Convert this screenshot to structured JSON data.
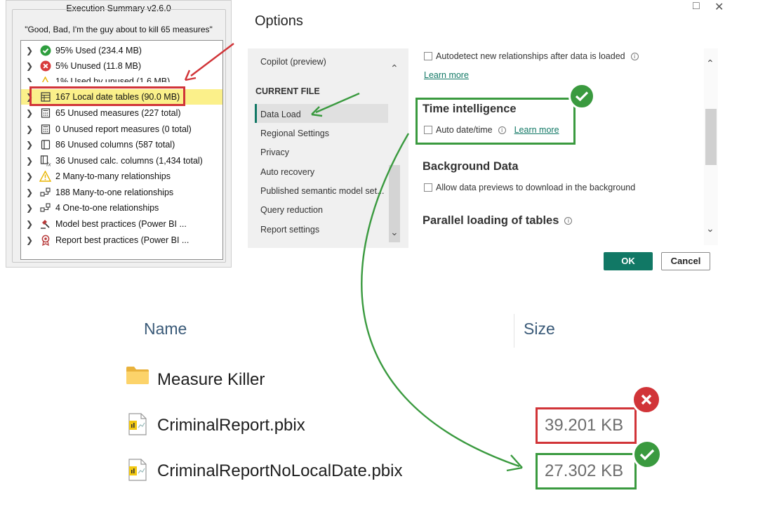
{
  "execution_summary": {
    "title": "Execution Summary v2.6.0",
    "quote": "\"Good, Bad, I'm the guy about to kill 65 measures\"",
    "items": [
      {
        "label": "95% Used (234.4 MB)",
        "icon": "check-circle-icon"
      },
      {
        "label": "5% Unused (11.8 MB)",
        "icon": "x-circle-icon"
      },
      {
        "label": "1% Used by unused (1.6 MB)",
        "icon": "warning-icon"
      },
      {
        "label": "167 Local date tables (90.0 MB)",
        "icon": "table-icon"
      },
      {
        "label": "65 Unused measures (227 total)",
        "icon": "calculator-icon"
      },
      {
        "label": "0 Unused report measures (0 total)",
        "icon": "calculator-icon"
      },
      {
        "label": "86 Unused columns (587 total)",
        "icon": "column-icon"
      },
      {
        "label": "36 Unused calc. columns (1,434 total)",
        "icon": "calc-column-icon"
      },
      {
        "label": "2 Many-to-many relationships",
        "icon": "warning-icon"
      },
      {
        "label": "188 Many-to-one relationships",
        "icon": "relationship-icon"
      },
      {
        "label": "4 One-to-one relationships",
        "icon": "relationship-icon"
      },
      {
        "label": "Model best practices (Power BI ...",
        "icon": "gavel-icon"
      },
      {
        "label": "Report best practices (Power BI ...",
        "icon": "award-icon"
      }
    ]
  },
  "options": {
    "title": "Options",
    "nav": {
      "top_item": "Copilot (preview)",
      "section_header": "CURRENT FILE",
      "items": [
        "Data Load",
        "Regional Settings",
        "Privacy",
        "Auto recovery",
        "Published semantic model set...",
        "Query reduction",
        "Report settings"
      ],
      "selected": "Data Load"
    },
    "content": {
      "autodetect_label": "Autodetect new relationships after data is loaded",
      "learn_more": "Learn more",
      "time_intelligence_title": "Time intelligence",
      "auto_date_label": "Auto date/time",
      "background_title": "Background Data",
      "background_label": "Allow data previews to download in the background",
      "parallel_title": "Parallel loading of tables"
    },
    "ok_label": "OK",
    "cancel_label": "Cancel"
  },
  "explorer": {
    "col_name": "Name",
    "col_size": "Size",
    "rows": [
      {
        "name": "Measure Killer",
        "size": "",
        "type": "folder"
      },
      {
        "name": "CriminalReport.pbix",
        "size": "39.201 KB",
        "type": "pbix"
      },
      {
        "name": "CriminalReportNoLocalDate.pbix",
        "size": "27.302 KB",
        "type": "pbix"
      }
    ]
  },
  "colors": {
    "accent": "#117865",
    "annotation_red": "#d13438",
    "annotation_green": "#3a9a3f",
    "highlight": "#fbf08a"
  }
}
